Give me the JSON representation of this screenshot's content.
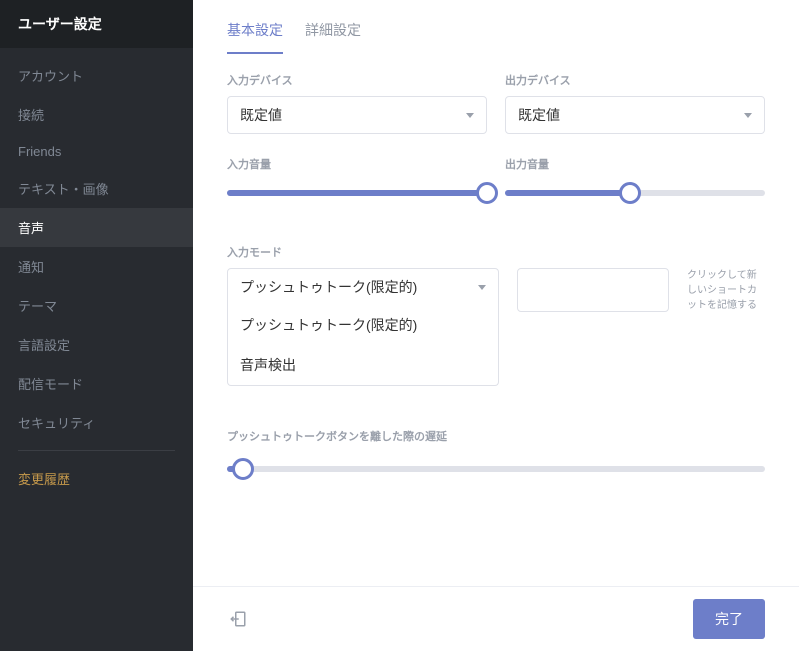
{
  "sidebar": {
    "header": "ユーザー設定",
    "items": [
      {
        "label": "アカウント"
      },
      {
        "label": "接続"
      },
      {
        "label": "Friends"
      },
      {
        "label": "テキスト・画像"
      },
      {
        "label": "音声",
        "active": true
      },
      {
        "label": "通知"
      },
      {
        "label": "テーマ"
      },
      {
        "label": "言語設定"
      },
      {
        "label": "配信モード"
      },
      {
        "label": "セキュリティ"
      }
    ],
    "changelog": "変更履歴"
  },
  "tabs": {
    "basic": "基本設定",
    "advanced": "詳細設定",
    "active": "basic"
  },
  "voice": {
    "input_device_label": "入力デバイス",
    "output_device_label": "出力デバイス",
    "input_device_value": "既定値",
    "output_device_value": "既定値",
    "input_volume_label": "入力音量",
    "output_volume_label": "出力音量",
    "input_volume_percent": 100,
    "output_volume_percent": 48,
    "input_mode_label": "入力モード",
    "input_mode_value": "プッシュトゥトーク(限定的)",
    "input_mode_options": [
      "プッシュトゥトーク(限定的)",
      "音声検出"
    ],
    "shortcut_hint": "クリックして新しいショートカットを記憶する",
    "release_delay_label": "プッシュトゥトークボタンを離した際の遅延",
    "release_delay_percent": 3
  },
  "footer": {
    "done": "完了"
  }
}
